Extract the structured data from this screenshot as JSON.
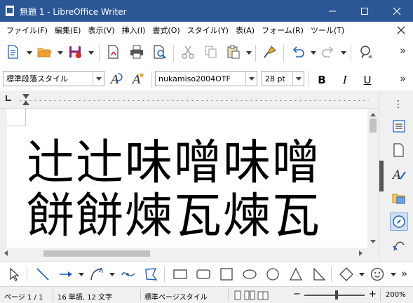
{
  "window": {
    "title": "無題 1 - LibreOffice Writer",
    "minimize_icon": "minimize-icon",
    "maximize_icon": "maximize-icon",
    "close_icon": "close-icon"
  },
  "menubar": {
    "items": [
      {
        "label": "ファイル(F)"
      },
      {
        "label": "編集(E)"
      },
      {
        "label": "表示(V)"
      },
      {
        "label": "挿入(I)"
      },
      {
        "label": "書式(O)"
      },
      {
        "label": "スタイル(Y)"
      },
      {
        "label": "表(A)"
      },
      {
        "label": "フォーム(R)"
      },
      {
        "label": "ツール(T)"
      }
    ]
  },
  "toolbar": {
    "more_label": "»",
    "icons": [
      "new-document-icon",
      "open-folder-icon",
      "save-icon",
      "export-pdf-icon",
      "print-icon",
      "print-preview-icon",
      "cut-icon",
      "copy-icon",
      "paste-icon",
      "clone-formatting-icon",
      "undo-icon",
      "redo-icon",
      "find-replace-icon"
    ]
  },
  "formatting": {
    "paragraph_style": "標準段落スタイル",
    "font_name": "nukamiso2004OTF",
    "font_size": "28 pt",
    "bold_label": "B",
    "italic_label": "I",
    "underline_label": "U",
    "more_label": "»"
  },
  "document": {
    "line1": "辻辻味噌味噌",
    "line2": "餅餅煉瓦煉瓦"
  },
  "sidebar": {
    "menu_label": "⋮",
    "icons": [
      "properties-icon",
      "page-icon",
      "styles-icon",
      "gallery-icon",
      "navigator-icon",
      "manage-changes-icon"
    ],
    "active": "navigator-icon"
  },
  "drawing": {
    "icons": [
      "select-arrow-icon",
      "line-icon",
      "line-arrow-icon",
      "curve-icon",
      "bezier-icon",
      "polygon-icon",
      "rectangle-icon",
      "rounded-rectangle-icon",
      "square-icon",
      "ellipse-icon",
      "circle-icon",
      "triangle-icon",
      "right-triangle-icon",
      "diamond-icon",
      "smiley-icon"
    ]
  },
  "statusbar": {
    "page": "ページ 1 / 1",
    "words": "16 単語, 12 文字",
    "page_style": "標準ページスタイル",
    "zoom_minus": "−",
    "zoom_plus": "+",
    "zoom": "200%"
  },
  "colors": {
    "titlebar": "#2b5796",
    "accent_blue": "#1f5fb3",
    "pdf_red": "#c8102e",
    "save_purple": "#8b2070",
    "folder_orange": "#f0a030"
  }
}
